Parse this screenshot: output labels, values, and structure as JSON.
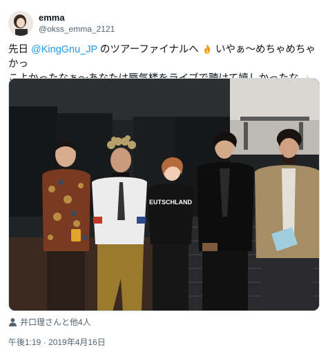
{
  "user": {
    "display_name": "emma",
    "handle": "@okss_emma_2121"
  },
  "tweet": {
    "line1_prefix": "先日 ",
    "mention": "@KingGnu_JP",
    "line1_suffix": " のツアーファイナルへ",
    "line1_tail": " いやぁ～めちゃめちゃかっ",
    "line2": "こよかったなぁ～あなたは蜃気楼をライブで聴けて嬉しかったな"
  },
  "photo": {
    "shirt_text": "EUTSCHLAND",
    "alt": "group photo"
  },
  "tagged": {
    "text": "井口理さんと他4人"
  },
  "timestamp": "午後1:19 · 2019年4月16日",
  "icons": {
    "fire": "fire-icon",
    "pray": "folded-hands-icon",
    "heart": "heart-exclamation-icon",
    "person": "person-icon"
  },
  "colors": {
    "mention": "#1d9bf0",
    "secondary_text": "#536471"
  }
}
